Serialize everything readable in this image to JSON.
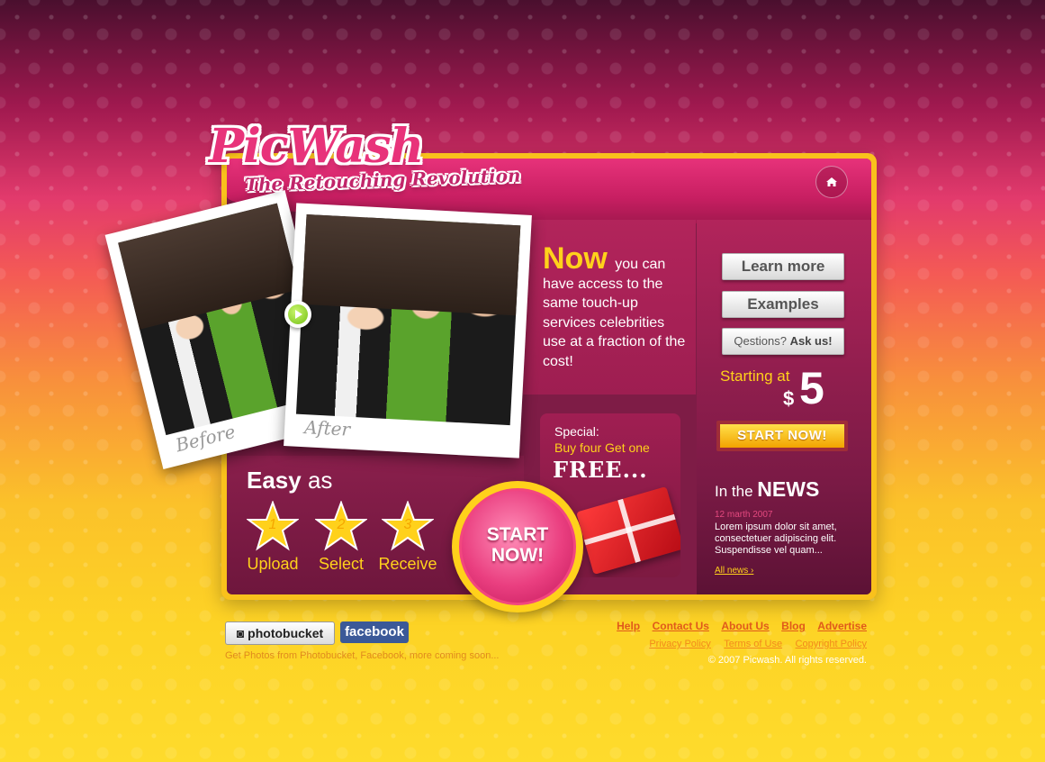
{
  "logo": {
    "name": "PicWash",
    "tagline": "The Retouching Revolution"
  },
  "header": {
    "home_icon": "home-icon"
  },
  "photos": {
    "before_caption": "Before",
    "after_caption": "After"
  },
  "intro": {
    "highlight": "Now",
    "text": "you can have access to the same touch-up services celebrities use at a fraction of the cost!"
  },
  "special": {
    "label": "Special:",
    "deal": "Buy four Get one",
    "free": "FREE..."
  },
  "sidebar_buttons": {
    "learn_more": "Learn more",
    "examples": "Examples",
    "questions_prefix": "Qestions?",
    "questions_cta": "Ask us!"
  },
  "pricing": {
    "starting_at": "Starting at",
    "currency": "$",
    "amount": "5",
    "start_button": "START NOW!"
  },
  "easy": {
    "title_bold": "Easy",
    "title_rest": "as",
    "steps": [
      {
        "num": "1",
        "label": "Upload"
      },
      {
        "num": "2",
        "label": "Select"
      },
      {
        "num": "3",
        "label": "Receive"
      }
    ]
  },
  "big_start": {
    "line1": "START",
    "line2": "NOW!"
  },
  "news": {
    "prefix": "In the",
    "title": "NEWS",
    "date": "12 marth 2007",
    "body": "Lorem ipsum dolor sit amet, consectetuer adipiscing elit. Suspendisse vel quam...",
    "all_link": "All news"
  },
  "footer": {
    "photobucket": "photobucket",
    "facebook": "facebook",
    "note": "Get Photos from Photobucket, Facebook, more coming soon...",
    "links": [
      "Help",
      "Contact Us",
      "About Us",
      "Blog",
      "Advertise"
    ],
    "policy_links": [
      "Privacy Policy",
      "Terms of Use",
      "Copyright Policy"
    ],
    "copyright": "© 2007 Picwash. All rights reserved."
  },
  "colors": {
    "accent_pink": "#e8337a",
    "accent_yellow": "#ffd11b",
    "panel_maroon": "#7e1c46"
  }
}
